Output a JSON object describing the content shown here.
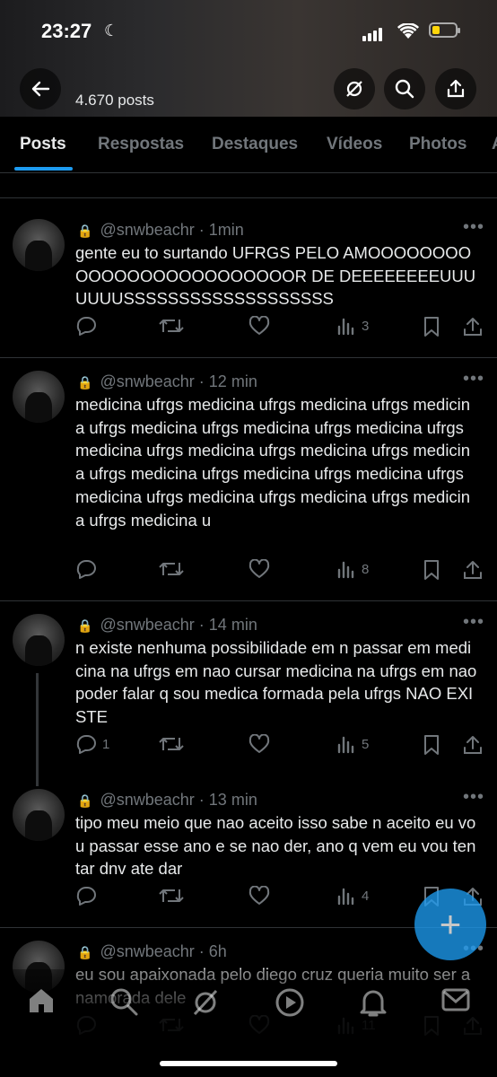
{
  "status": {
    "time": "23:27"
  },
  "header": {
    "post_count": "4.670 posts"
  },
  "tabs": [
    {
      "label": "Posts",
      "active": true
    },
    {
      "label": "Respostas"
    },
    {
      "label": "Destaques"
    },
    {
      "label": "Vídeos"
    },
    {
      "label": "Photos"
    },
    {
      "label": "A"
    }
  ],
  "posts": [
    {
      "handle": "@snwbeachr",
      "sep": "·",
      "time": "1min",
      "text": "gente eu to surtando UFRGS PELO AMOOOOOOOOOOOOOOOOOOOOOOOOOR DE DEEEEEEEEUUUUUUUSSSSSSSSSSSSSSSSSSS",
      "replies": "",
      "reposts": "",
      "views": "3"
    },
    {
      "handle": "@snwbeachr",
      "sep": "·",
      "time": "12 min",
      "text": "medicina ufrgs medicina ufrgs medicina ufrgs medicina ufrgs medicina ufrgs medicina ufrgs medicina ufrgs medicina ufrgs medicina ufrgs medicina ufrgs medicina ufrgs medicina ufrgs medicina ufrgs medicina ufrgs medicina ufrgs medicina ufrgs medicina ufrgs medicina ufrgs medicina u",
      "replies": "",
      "reposts": "",
      "views": "8"
    },
    {
      "handle": "@snwbeachr",
      "sep": "·",
      "time": "14 min",
      "text": "n existe nenhuma possibilidade em n passar em medicina na ufrgs em nao cursar  medicina na ufrgs em nao poder falar q sou medica formada pela ufrgs NAO EXISTE",
      "replies": "1",
      "reposts": "",
      "views": "5"
    },
    {
      "handle": "@snwbeachr",
      "sep": "·",
      "time": "13 min",
      "text": "tipo meu meio que nao aceito isso sabe n aceito eu vou passar esse ano e se nao der, ano q vem eu vou tentar dnv ate dar",
      "replies": "",
      "reposts": "",
      "views": "4"
    },
    {
      "handle": "@snwbeachr",
      "sep": "·",
      "time": "6h",
      "text": "eu sou apaixonada pelo diego cruz queria muito ser a namorada dele",
      "replies": "",
      "reposts": "",
      "views": "11"
    }
  ],
  "fab": {
    "label": "+"
  },
  "colors": {
    "accent": "#1d9bf0",
    "background": "#000000",
    "muted": "#71767b",
    "text": "#e7e9ea"
  }
}
